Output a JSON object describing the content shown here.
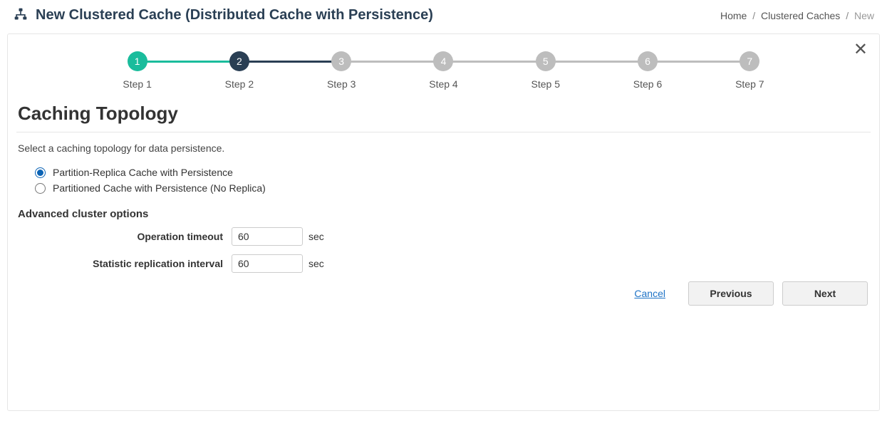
{
  "header": {
    "title": "New Clustered Cache (Distributed Cache with Persistence)"
  },
  "breadcrumb": {
    "home": "Home",
    "mid": "Clustered Caches",
    "current": "New",
    "sep": "/"
  },
  "stepper": {
    "steps": [
      {
        "num": "1",
        "label": "Step 1",
        "state": "completed",
        "line": "done"
      },
      {
        "num": "2",
        "label": "Step 2",
        "state": "active",
        "line": "active-line"
      },
      {
        "num": "3",
        "label": "Step 3",
        "state": "pending",
        "line": "todo"
      },
      {
        "num": "4",
        "label": "Step 4",
        "state": "pending",
        "line": "todo"
      },
      {
        "num": "5",
        "label": "Step 5",
        "state": "pending",
        "line": "todo"
      },
      {
        "num": "6",
        "label": "Step 6",
        "state": "pending",
        "line": "todo"
      },
      {
        "num": "7",
        "label": "Step 7",
        "state": "pending",
        "line": ""
      }
    ]
  },
  "section": {
    "heading": "Caching Topology",
    "description": "Select a caching topology for data persistence."
  },
  "topology_options": {
    "opt1": "Partition-Replica Cache with Persistence",
    "opt2": "Partitioned Cache with Persistence (No Replica)"
  },
  "advanced": {
    "heading": "Advanced cluster options",
    "operation_timeout_label": "Operation timeout",
    "operation_timeout_value": "60",
    "stat_interval_label": "Statistic replication interval",
    "stat_interval_value": "60",
    "unit": "sec"
  },
  "footer": {
    "cancel": "Cancel",
    "previous": "Previous",
    "next": "Next"
  }
}
